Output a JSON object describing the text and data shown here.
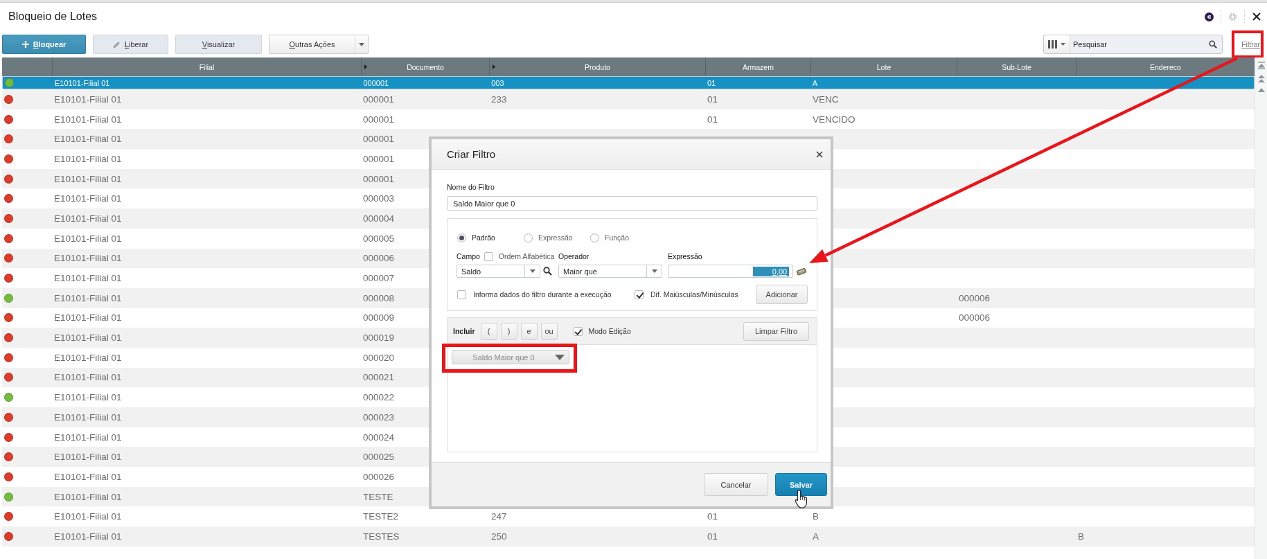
{
  "window": {
    "title": "Bloqueio de Lotes"
  },
  "toolbar": {
    "buttons": [
      {
        "label": "Bloquear",
        "kind": "primary",
        "hotkey_underlined": true
      },
      {
        "label": "Liberar",
        "kind": "edit",
        "hotkey_underlined": true
      },
      {
        "label": "Visualizar",
        "kind": "plain",
        "hotkey_underlined": true
      },
      {
        "label": "Outras Ações",
        "kind": "dropdown",
        "hotkey_underlined": true
      }
    ],
    "search": {
      "placeholder": "Pesquisar"
    },
    "filter_link": "Filtrar"
  },
  "table": {
    "columns": [
      {
        "label": "Filial",
        "caret": false
      },
      {
        "label": "Documento",
        "caret": true
      },
      {
        "label": "Produto",
        "caret": true
      },
      {
        "label": "Armazem",
        "caret": false
      },
      {
        "label": "Lote",
        "caret": false
      },
      {
        "label": "Sub-Lote",
        "caret": false
      },
      {
        "label": "Endereco",
        "caret": false
      }
    ],
    "rows": [
      {
        "color": "#74bb3f",
        "selected": true,
        "filial": "E10101-Filial 01",
        "documento": "000001",
        "produto": "003",
        "armazem": "01",
        "lote": "A"
      },
      {
        "color": "#dc3d2b",
        "selected": false,
        "filial": "E10101-Filial 01",
        "documento": "000001",
        "produto": "233",
        "armazem": "01",
        "lote": "VENC"
      },
      {
        "color": "#dc3d2b",
        "selected": false,
        "filial": "E10101-Filial 01",
        "documento": "000001",
        "armazem": "01",
        "lote": "VENCIDO"
      },
      {
        "color": "#dc3d2b",
        "selected": false,
        "filial": "E10101-Filial 01",
        "documento": "000001"
      },
      {
        "color": "#dc3d2b",
        "selected": false,
        "filial": "E10101-Filial 01",
        "documento": "000001"
      },
      {
        "color": "#dc3d2b",
        "selected": false,
        "filial": "E10101-Filial 01",
        "documento": "000001"
      },
      {
        "color": "#dc3d2b",
        "selected": false,
        "filial": "E10101-Filial 01",
        "documento": "000003"
      },
      {
        "color": "#dc3d2b",
        "selected": false,
        "filial": "E10101-Filial 01",
        "documento": "000004"
      },
      {
        "color": "#dc3d2b",
        "selected": false,
        "filial": "E10101-Filial 01",
        "documento": "000005"
      },
      {
        "color": "#dc3d2b",
        "selected": false,
        "filial": "E10101-Filial 01",
        "documento": "000006"
      },
      {
        "color": "#dc3d2b",
        "selected": false,
        "filial": "E10101-Filial 01",
        "documento": "000007"
      },
      {
        "color": "#74bb3f",
        "selected": false,
        "filial": "E10101-Filial 01",
        "documento": "000008",
        "sub_lote": "000006"
      },
      {
        "color": "#dc3d2b",
        "selected": false,
        "filial": "E10101-Filial 01",
        "documento": "000009",
        "sub_lote": "000006"
      },
      {
        "color": "#dc3d2b",
        "selected": false,
        "filial": "E10101-Filial 01",
        "documento": "000019"
      },
      {
        "color": "#dc3d2b",
        "selected": false,
        "filial": "E10101-Filial 01",
        "documento": "000020"
      },
      {
        "color": "#dc3d2b",
        "selected": false,
        "filial": "E10101-Filial 01",
        "documento": "000021"
      },
      {
        "color": "#74bb3f",
        "selected": false,
        "filial": "E10101-Filial 01",
        "documento": "000022"
      },
      {
        "color": "#dc3d2b",
        "selected": false,
        "filial": "E10101-Filial 01",
        "documento": "000023"
      },
      {
        "color": "#dc3d2b",
        "selected": false,
        "filial": "E10101-Filial 01",
        "documento": "000024"
      },
      {
        "color": "#dc3d2b",
        "selected": false,
        "filial": "E10101-Filial 01",
        "documento": "000025"
      },
      {
        "color": "#dc3d2b",
        "selected": false,
        "filial": "E10101-Filial 01",
        "documento": "000026"
      },
      {
        "color": "#74bb3f",
        "selected": false,
        "filial": "E10101-Filial 01",
        "documento": "TESTE"
      },
      {
        "color": "#dc3d2b",
        "selected": false,
        "filial": "E10101-Filial 01",
        "documento": "TESTE2",
        "produto": "247",
        "armazem": "01",
        "lote": "B"
      },
      {
        "color": "#dc3d2b",
        "selected": false,
        "filial": "E10101-Filial 01",
        "documento": "TESTES",
        "produto": "250",
        "armazem": "01",
        "lote": "A",
        "endereco": "B"
      }
    ]
  },
  "dialog": {
    "title": "Criar Filtro",
    "name_field": {
      "label": "Nome do Filtro",
      "value": "Saldo Maior que 0"
    },
    "modes": [
      {
        "label": "Padrão",
        "selected": true
      },
      {
        "label": "Expressão",
        "selected": false
      },
      {
        "label": "Função",
        "selected": false
      }
    ],
    "field": {
      "label": "Campo",
      "value": "Saldo"
    },
    "alphabetical": {
      "label": "Ordem Alfabética",
      "checked": false
    },
    "operator": {
      "label": "Operador",
      "value": "Maior que"
    },
    "expression": {
      "label": "Expressão",
      "value": "0,00",
      "value_selected": true
    },
    "options": [
      {
        "label": "Informa dados do filtro durante a execução",
        "checked": false
      },
      {
        "label": "Dif. Maiúsculas/Minúsculas",
        "checked": true
      }
    ],
    "add_button": "Adicionar",
    "include": {
      "label": "Incluir",
      "buttons": [
        "(",
        ")",
        "e",
        "ou"
      ]
    },
    "edit_mode": {
      "label": "Modo Edição",
      "checked": true
    },
    "clear_button": "Limpar Filtro",
    "expression_items": [
      "Saldo Maior que 0"
    ],
    "buttons": [
      {
        "label": "Cancelar",
        "kind": "secondary"
      },
      {
        "label": "Salvar",
        "kind": "primary"
      }
    ]
  }
}
